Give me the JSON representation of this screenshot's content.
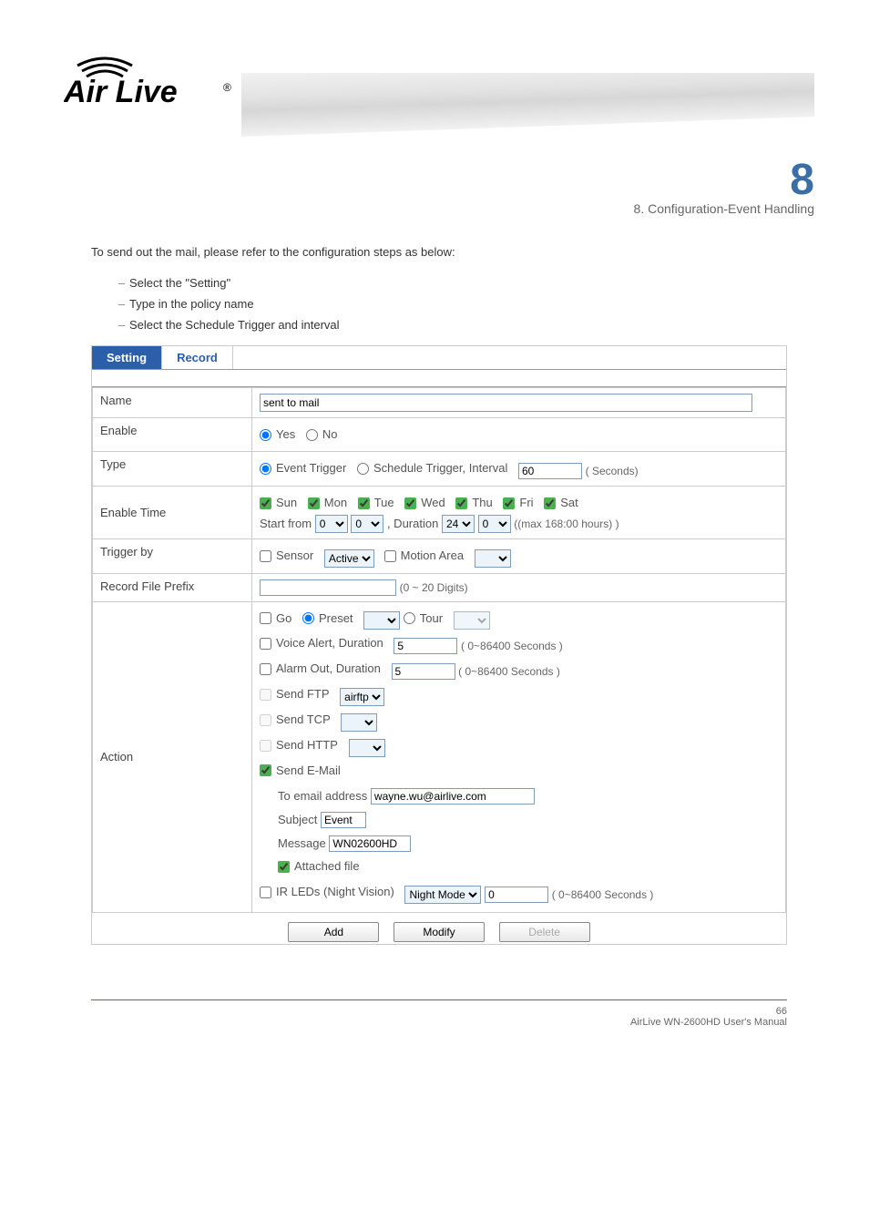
{
  "chapter": {
    "num": "8",
    "title": "8. Configuration-Event Handling"
  },
  "intro": "To send out the mail, please refer to the configuration steps as below:",
  "steps": [
    "Select the \"Setting\"",
    "Type in the policy name",
    "Select the Schedule Trigger and interval"
  ],
  "tabs": {
    "setting": "Setting",
    "record": "Record"
  },
  "form": {
    "name": {
      "label": "Name",
      "value": "sent to mail"
    },
    "enable": {
      "label": "Enable",
      "yes": "Yes",
      "no": "No"
    },
    "type": {
      "label": "Type",
      "event": "Event Trigger",
      "schedule": "Schedule Trigger, Interval",
      "interval": "60",
      "unit": "( Seconds)"
    },
    "enable_time": {
      "label": "Enable Time",
      "days": [
        "Sun",
        "Mon",
        "Tue",
        "Wed",
        "Thu",
        "Fri",
        "Sat"
      ],
      "start_label": "Start from",
      "start_h": "0",
      "start_m": "0",
      "dur_label": ", Duration",
      "dur_h": "24",
      "dur_m": "0",
      "max": "((max 168:00 hours) )"
    },
    "trigger_by": {
      "label": "Trigger by",
      "sensor": "Sensor",
      "sensor_val": "Active",
      "motion": "Motion Area"
    },
    "prefix": {
      "label": "Record File Prefix",
      "hint": "(0 ~ 20 Digits)"
    },
    "action": {
      "label": "Action",
      "go": "Go",
      "preset": "Preset",
      "tour": "Tour",
      "voice": "Voice Alert, Duration",
      "voice_val": "5",
      "voice_hint": "( 0~86400 Seconds )",
      "alarm": "Alarm Out, Duration",
      "alarm_val": "5",
      "alarm_hint": "( 0~86400 Seconds )",
      "ftp": "Send FTP",
      "ftp_val": "airftp",
      "tcp": "Send TCP",
      "http": "Send HTTP",
      "mail": "Send E-Mail",
      "mail_to_lbl": "To email address",
      "mail_to": "wayne.wu@airlive.com",
      "subj_lbl": "Subject",
      "subj": "Event",
      "msg_lbl": "Message",
      "msg": "WN02600HD",
      "attach": "Attached file",
      "ir": "IR LEDs (Night Vision)",
      "ir_mode": "Night Mode",
      "ir_val": "0",
      "ir_hint": "( 0~86400 Seconds )"
    }
  },
  "buttons": {
    "add": "Add",
    "modify": "Modify",
    "delete": "Delete"
  },
  "footer": {
    "left": "AirLive WN-2600HD User's Manual",
    "page": "66"
  }
}
